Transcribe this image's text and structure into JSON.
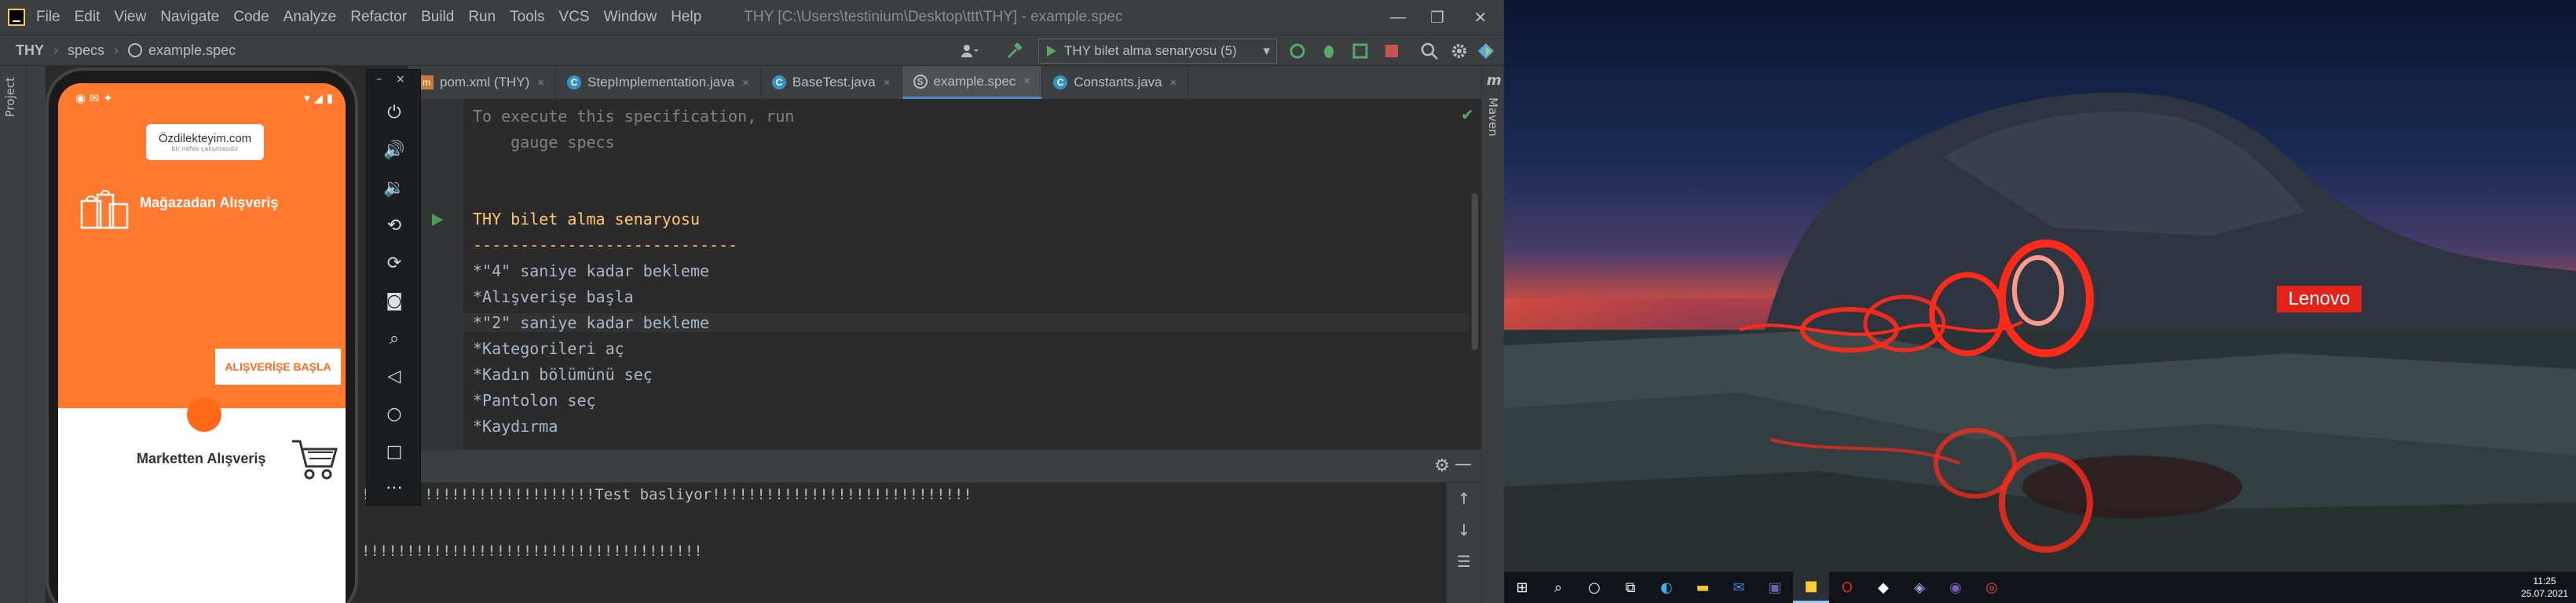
{
  "ide": {
    "menu": [
      "File",
      "Edit",
      "View",
      "Navigate",
      "Code",
      "Analyze",
      "Refactor",
      "Build",
      "Run",
      "Tools",
      "VCS",
      "Window",
      "Help"
    ],
    "window_title": "THY [C:\\Users\\testinium\\Desktop\\ttt\\THY] - example.spec",
    "breadcrumb": {
      "project": "THY",
      "folder": "specs",
      "file": "example.spec"
    },
    "run_config": "THY bilet alma senaryosu (5)",
    "left_tool": "Project",
    "right_tool": "Maven",
    "tabs": [
      {
        "label": "pom.xml (THY)",
        "type": "maven"
      },
      {
        "label": "StepImplementation.java",
        "type": "class"
      },
      {
        "label": "BaseTest.java",
        "type": "class"
      },
      {
        "label": "example.spec",
        "type": "spec"
      },
      {
        "label": "Constants.java",
        "type": "class"
      }
    ],
    "editor_lines": [
      "To execute this specification, run",
      "    gauge specs",
      "",
      "",
      "THY bilet alma senaryosu",
      "----------------------------",
      "*\"4\" saniye kadar bekleme",
      "*Alışverişe başla",
      "*\"2\" saniye kadar bekleme",
      "*Kategorileri aç",
      "*Kadın bölümünü seç",
      "*Pantolon seç",
      "*Kaydırma"
    ],
    "console_lines": [
      "!!!!!!!!!!!!!!!!!!!!!!!!!!Test basliyor!!!!!!!!!!!!!!!!!!!!!!!!!!!!!",
      "",
      "!!!!!!!!!!!!!!!!!!!!!!!!!!!!!!!!!!!!!!"
    ]
  },
  "phone": {
    "brand": "Özdilekteyim.com",
    "brand_sub": "bir nefes çalışmasıdır",
    "store_title": "Mağazadan Alışveriş",
    "start_button": "ALIŞVERİŞE BAŞLA",
    "market_title": "Marketten Alışveriş"
  },
  "desktop": {
    "wallpaper_logo": "Lenovo",
    "clock_time": "11:25",
    "clock_date": "25.07.2021"
  }
}
